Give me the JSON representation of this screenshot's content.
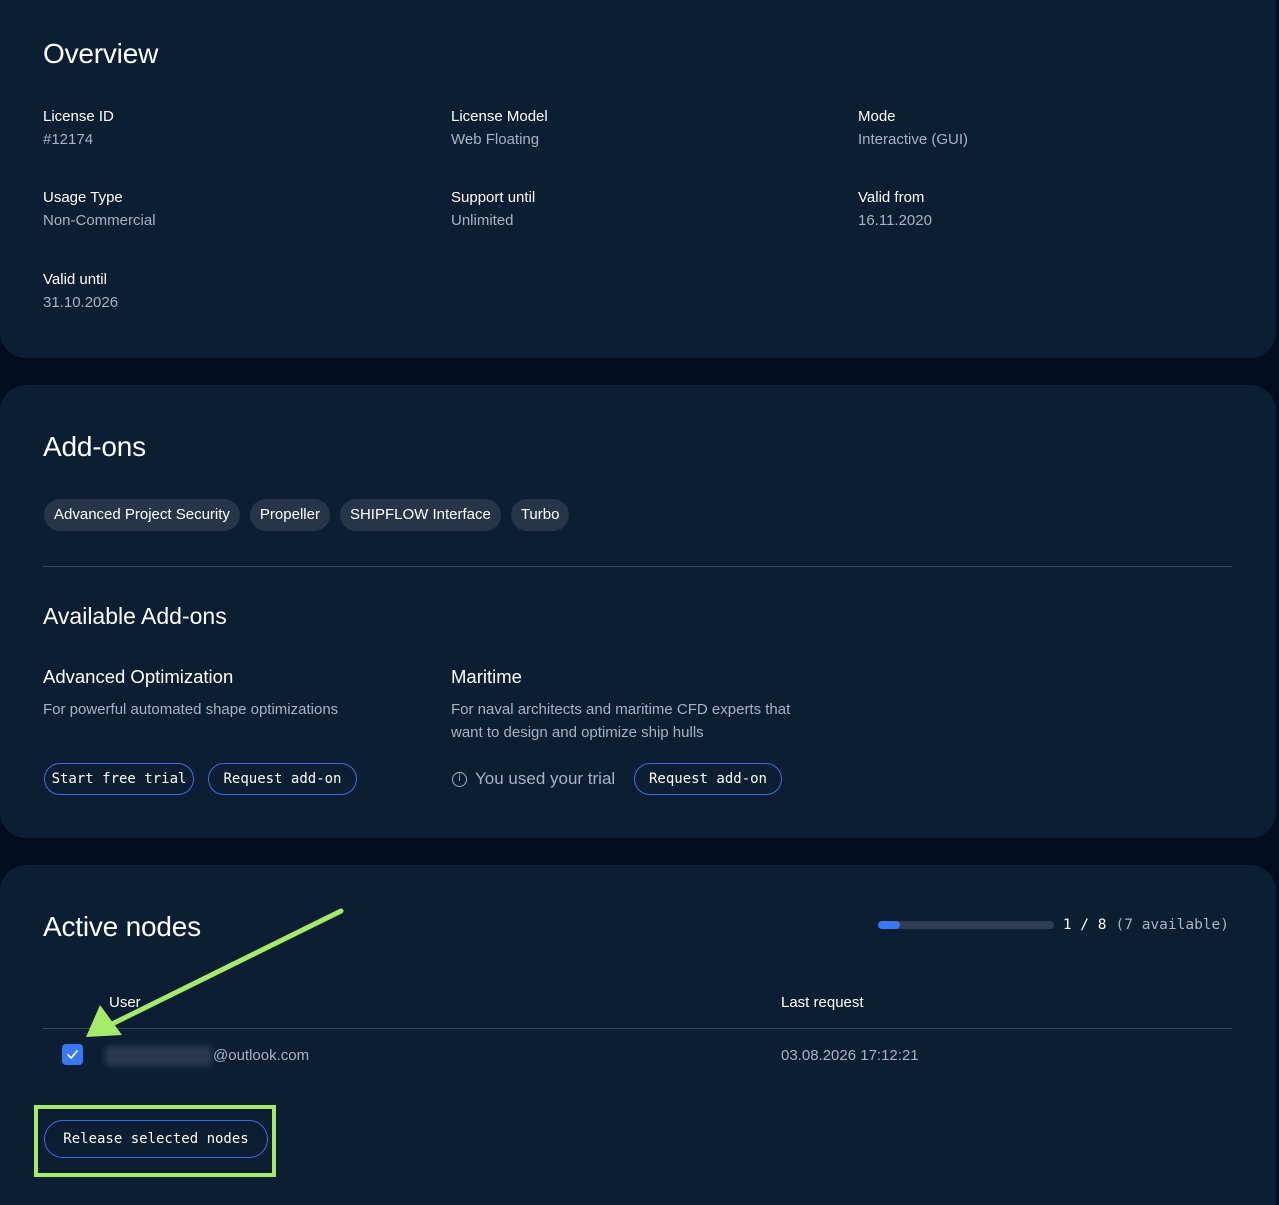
{
  "overview": {
    "title": "Overview",
    "fields": [
      {
        "label": "License ID",
        "value": "#12174"
      },
      {
        "label": "License Model",
        "value": "Web Floating"
      },
      {
        "label": "Mode",
        "value": "Interactive (GUI)"
      },
      {
        "label": "Usage Type",
        "value": "Non-Commercial"
      },
      {
        "label": "Support until",
        "value": "Unlimited"
      },
      {
        "label": "Valid from",
        "value": "16.11.2020"
      },
      {
        "label": "Valid until",
        "value": "31.10.2026"
      }
    ]
  },
  "addons": {
    "title": "Add-ons",
    "active": [
      "Advanced Project Security",
      "Propeller",
      "SHIPFLOW Interface",
      "Turbo"
    ],
    "available_title": "Available Add-ons",
    "available": [
      {
        "name": "Advanced Optimization",
        "description": "For powerful automated shape optimizations",
        "trial_button": "Start free trial",
        "request_button": "Request add-on"
      },
      {
        "name": "Maritime",
        "description_line1": "For naval architects and maritime CFD experts that",
        "description_line2": "want to design and optimize ship hulls",
        "trial_note": "You used your trial",
        "request_button": "Request add-on"
      }
    ]
  },
  "nodes": {
    "title": "Active nodes",
    "usage": {
      "used_text": "1 / 8",
      "available_text": "(7 available)",
      "used": 1,
      "total": 8
    },
    "columns": {
      "user": "User",
      "last_request": "Last request"
    },
    "rows": [
      {
        "user_suffix": "@outlook.com",
        "last_request": "03.08.2026 17:12:21",
        "selected": true
      }
    ],
    "release_button": "Release selected nodes"
  },
  "colors": {
    "accent": "#3a78f2",
    "annotation": "#a6ea6c",
    "card": "#0b1e33",
    "background": "#020d1f"
  }
}
